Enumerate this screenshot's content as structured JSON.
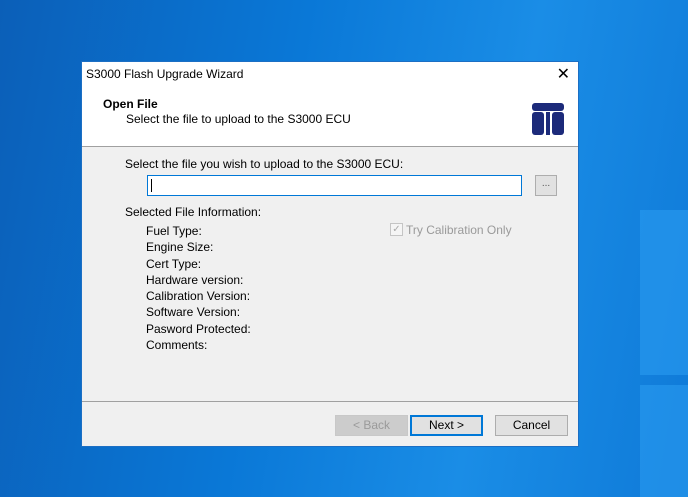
{
  "window": {
    "title": "S3000 Flash Upgrade Wizard"
  },
  "header": {
    "title": "Open File",
    "subtitle": "Select the file to upload to the S3000 ECU"
  },
  "prompt": "Select the file you wish to upload to the S3000 ECU:",
  "file_input": {
    "value": ""
  },
  "browse_label": "...",
  "info_heading": "Selected File Information:",
  "info_fields": [
    "Fuel Type:",
    "Engine Size:",
    "Cert Type:",
    "Hardware version:",
    "Calibration Version:",
    "Software Version:",
    "Pasword Protected:",
    "Comments:"
  ],
  "try_calibration": {
    "label": "Try Calibration Only",
    "checked": true,
    "enabled": false
  },
  "buttons": {
    "back": "< Back",
    "next": "Next >",
    "cancel": "Cancel"
  }
}
